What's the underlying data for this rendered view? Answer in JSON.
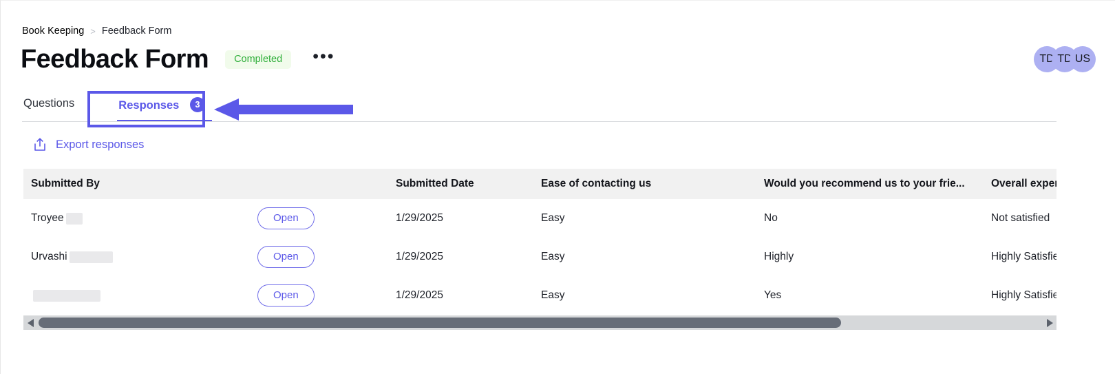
{
  "breadcrumb": {
    "root": "Book Keeping",
    "separator": ">",
    "current": "Feedback Form"
  },
  "header": {
    "title": "Feedback Form",
    "status": "Completed",
    "status_color": "#2fae3a",
    "status_bg": "#f1fbeb",
    "more_glyph": "•••"
  },
  "avatars": [
    {
      "initials": "TD"
    },
    {
      "initials": "TD"
    },
    {
      "initials": "US"
    }
  ],
  "tabs": [
    {
      "label": "Questions",
      "active": false,
      "count": ""
    },
    {
      "label": "Responses",
      "active": true,
      "count": "3"
    }
  ],
  "accent_color": "#5b58e8",
  "toolbar": {
    "export_label": "Export responses",
    "export_icon": "share-upload-icon"
  },
  "table": {
    "columns": [
      "Submitted By",
      "",
      "Submitted Date",
      "Ease of contacting us",
      "Would you recommend us to your frie...",
      "Overall experience getting your goal a..."
    ],
    "open_label": "Open",
    "rows": [
      {
        "name": "Troyee",
        "name_redacted_width": 24,
        "date": "1/29/2025",
        "ease": "Easy",
        "recommend": "No",
        "experience": "Not satisfied"
      },
      {
        "name": "Urvashi",
        "name_redacted_width": 63,
        "date": "1/29/2025",
        "ease": "Easy",
        "recommend": "Highly",
        "experience": "Highly Satisfied"
      },
      {
        "name": "",
        "name_redacted_width": 98,
        "date": "1/29/2025",
        "ease": "Easy",
        "recommend": "Yes",
        "experience": "Highly Satisfied"
      }
    ]
  },
  "scrollbar": {
    "left_arrow": "◀",
    "right_arrow": "▶"
  }
}
